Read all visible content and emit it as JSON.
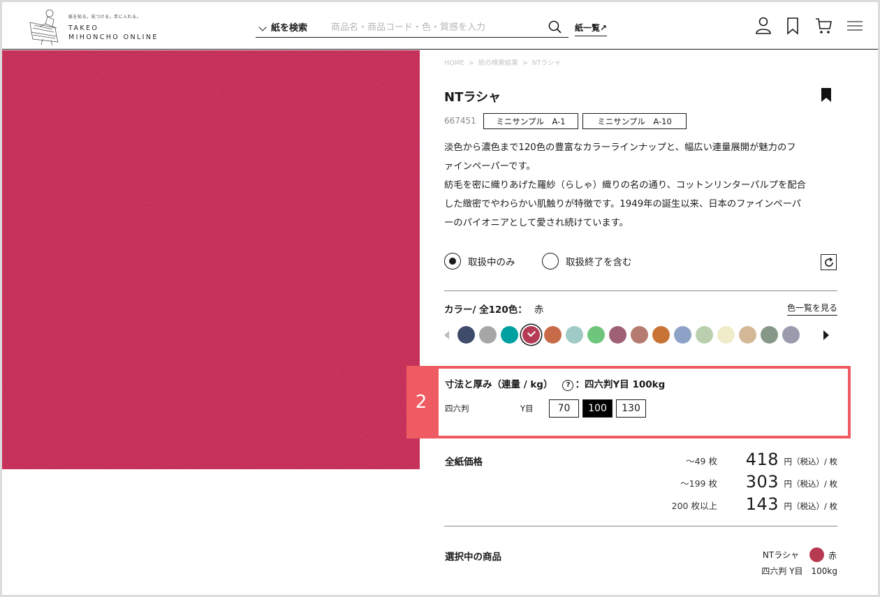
{
  "header": {
    "logo_tagline": "紙を知る。見つける。手に入れる。",
    "logo_line1": "TAKEO",
    "logo_line2": "MIHONCHO ONLINE",
    "search_dropdown": "紙を検索",
    "search_placeholder": "商品名・商品コード・色・質感を入力",
    "list_link": "紙一覧↗",
    "icons": [
      "user-icon",
      "bookmark-icon",
      "cart-icon",
      "menu-icon"
    ]
  },
  "breadcrumb": [
    "HOME",
    "紙の検索結果",
    "NTラシャ"
  ],
  "product": {
    "name": "NTラシャ",
    "code": "667451",
    "tags": [
      "ミニサンプル　A-1",
      "ミニサンプル　A-10"
    ],
    "description": [
      "淡色から濃色まで120色の豊富なカラーラインナップと、幅広い連量展開が魅力のフ",
      "ァインペーパーです。",
      "紡毛を密に織りあげた羅紗（らしゃ）織りの名の通り、コットンリンターパルプを配合",
      "した緻密でやわらかい肌触りが特徴です。1949年の誕生以来、日本のファインペーパ",
      "ーのパイオニアとして愛され続けています。"
    ],
    "image_color": "#c0254f"
  },
  "filter": {
    "options": [
      "取扱中のみ",
      "取扱終了を含む"
    ],
    "selected": "取扱中のみ"
  },
  "color": {
    "label": "カラー/ 全120色：",
    "selected_name": "赤",
    "link": "色一覧を見る",
    "swatches": [
      "#3f4b6b",
      "#a6a6a6",
      "#00a0a0",
      "#b43a55",
      "#c66a48",
      "#9fcac5",
      "#6ec67d",
      "#9e6075",
      "#b57b70",
      "#c97436",
      "#8ea2c7",
      "#b9cfad",
      "#f0ebc9",
      "#d2b896",
      "#869887",
      "#9a9cad"
    ],
    "selected_index": 3
  },
  "size": {
    "title": "寸法と厚み（連量 / kg）",
    "help": "?",
    "current": "：四六判Y目 100kg",
    "format": "四六判",
    "grain": "Y目",
    "weights": [
      "70",
      "100",
      "130"
    ],
    "selected_weight": "100",
    "step_number": "2"
  },
  "prices": {
    "title": "全紙価格",
    "rows": [
      {
        "qty": "～49 枚",
        "price": "418",
        "unit": "円（税込）/ 枚"
      },
      {
        "qty": "～199 枚",
        "price": "303",
        "unit": "円（税込）/ 枚"
      },
      {
        "qty": "200 枚以上",
        "price": "143",
        "unit": "円（税込）/ 枚"
      }
    ]
  },
  "selection": {
    "title": "選択中の商品",
    "name": "NTラシャ",
    "color": "赤",
    "color_hex": "#b73a52",
    "spec": "四六判 Y目　100kg"
  }
}
